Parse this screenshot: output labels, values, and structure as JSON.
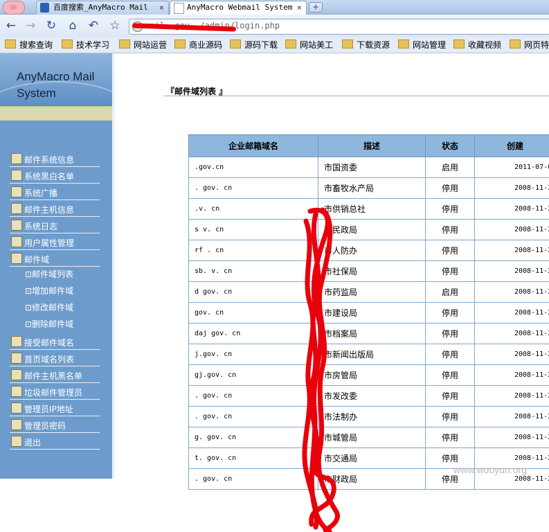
{
  "browser": {
    "tabs": [
      {
        "label": "百度搜索_AnyMacro Mail",
        "close": "×"
      },
      {
        "label": "AnyMacro Webmail System",
        "close": "×"
      }
    ],
    "new_tab": "+",
    "url": "mail.gov.cn/admin/login.php",
    "url_visible": "mail·  gov.  /admin/login.php",
    "bookmarks": [
      "搜索查询",
      "技术学习",
      "网站运营",
      "商业源码",
      "源码下载",
      "网站美工",
      "下载资源",
      "网站管理",
      "收藏视频",
      "网页特"
    ]
  },
  "sidebar": {
    "logo_line1": "AnyMacro Mail",
    "logo_line2": "System",
    "items": [
      {
        "label": "邮件系统信息"
      },
      {
        "label": "系统黑白名单"
      },
      {
        "label": "系统广播"
      },
      {
        "label": "邮件主机信息"
      },
      {
        "label": "系统日志"
      },
      {
        "label": "用户属性管理"
      },
      {
        "label": "邮件域"
      }
    ],
    "sub_items": [
      {
        "label": "⊡邮件域列表"
      },
      {
        "label": "⊡增加邮件域"
      },
      {
        "label": "⊡修改邮件域"
      },
      {
        "label": "⊡删除邮件域"
      }
    ],
    "items_after": [
      {
        "label": "接受邮件域名"
      },
      {
        "label": "首页域名列表"
      },
      {
        "label": "邮件主机黑名单"
      },
      {
        "label": "垃圾邮件管理员"
      },
      {
        "label": "管理员IP地址"
      },
      {
        "label": "管理员密码"
      },
      {
        "label": "退出"
      }
    ]
  },
  "main": {
    "title": "『邮件域列表 』",
    "table": {
      "headers": [
        "企业邮箱域名",
        "描述",
        "状态",
        "创建"
      ],
      "rows": [
        {
          "domain": ".gov.cn",
          "desc": "市国资委",
          "status": "启用",
          "date": "2011-07-0"
        },
        {
          "domain": "  . gov. cn",
          "desc": "市畜牧水产局",
          "status": "停用",
          "date": "2008-11-2"
        },
        {
          "domain": "  .v. cn",
          "desc": "市供销总社",
          "status": "停用",
          "date": "2008-11-2"
        },
        {
          "domain": "s   v. cn",
          "desc": "市民政局",
          "status": "停用",
          "date": "2008-11-2"
        },
        {
          "domain": "  rf   . cn",
          "desc": "市人防办",
          "status": "停用",
          "date": "2008-11-2"
        },
        {
          "domain": "  sb.   v. cn",
          "desc": "市社保局",
          "status": "停用",
          "date": "2008-11-2"
        },
        {
          "domain": "   d  gov. cn",
          "desc": "市药监局",
          "status": "启用",
          "date": "2008-11-2"
        },
        {
          "domain": "    gov. cn",
          "desc": "市建设局",
          "status": "停用",
          "date": "2008-11-2"
        },
        {
          "domain": "  daj  gov. cn",
          "desc": "市档案局",
          "status": "停用",
          "date": "2008-11-2"
        },
        {
          "domain": "    j.gov. cn",
          "desc": "市新闻出版局",
          "status": "停用",
          "date": "2008-11-2"
        },
        {
          "domain": "    gj.gov. cn",
          "desc": "市房管局",
          "status": "停用",
          "date": "2008-11-2"
        },
        {
          "domain": "    . gov. cn",
          "desc": "市发改委",
          "status": "停用",
          "date": "2008-11-2"
        },
        {
          "domain": "    . gov. cn",
          "desc": "市法制办",
          "status": "停用",
          "date": "2008-11-2"
        },
        {
          "domain": "    g. gov. cn",
          "desc": "市城管局",
          "status": "停用",
          "date": "2008-11-2"
        },
        {
          "domain": "    t. gov. cn",
          "desc": "市交通局",
          "status": "停用",
          "date": "2008-11-2"
        },
        {
          "domain": "  . gov. cn",
          "desc": "市财政局",
          "status": "停用",
          "date": "2008-11-2"
        }
      ]
    }
  },
  "watermark": "www.wooyun.org",
  "colors": {
    "sidebar": "#6d9ccc",
    "table_header": "#8fb7de",
    "redaction": "#e8000b"
  }
}
